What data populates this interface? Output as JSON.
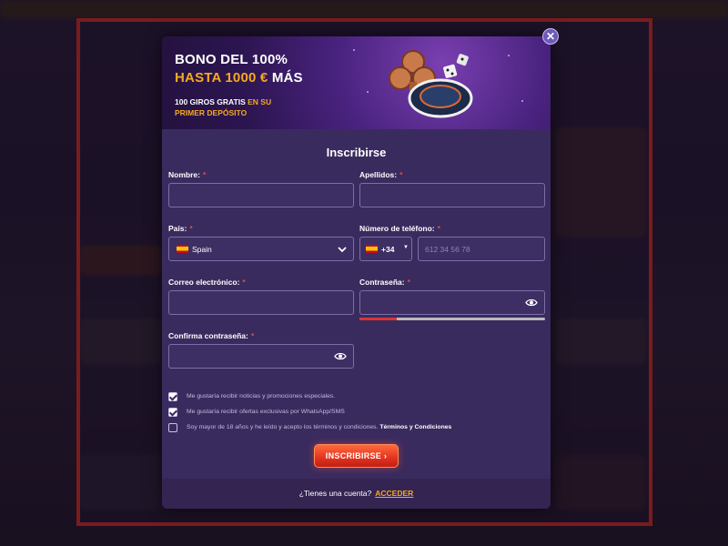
{
  "banner": {
    "line1": "BONO DEL 100%",
    "line2_accent": "HASTA 1000 €",
    "line2_white": " MÁS",
    "sub_white": "100 GIROS GRATIS",
    "sub_accent": " EN SU PRIMER DEPÓSITO"
  },
  "close_label": "✕",
  "form": {
    "title": "Inscribirse",
    "required_mark": "*",
    "first_name": {
      "label": "Nombre:",
      "value": ""
    },
    "last_name": {
      "label": "Apellidos:",
      "value": ""
    },
    "country": {
      "label": "País:",
      "value": "Spain"
    },
    "phone": {
      "label": "Número de teléfono:",
      "code": "+34",
      "placeholder": "612 34 56 78"
    },
    "email": {
      "label": "Correo electrónico:",
      "value": ""
    },
    "password": {
      "label": "Contraseña:",
      "strength": 0.2
    },
    "confirm_password": {
      "label": "Confirma contraseña:"
    },
    "checkboxes": [
      {
        "text": "Me gustaría recibir noticias y promociones especiales.",
        "checked": true
      },
      {
        "text": "Me gustaría recibir ofertas exclusivas por WhatsApp/SMS",
        "checked": true
      },
      {
        "text": "Soy mayor de 18 años y he leído y acepto los términos y condiciones.",
        "link": "Términos y Condiciones",
        "checked": false
      }
    ],
    "submit_label": "INSCRIBIRSE ›"
  },
  "footer": {
    "question": "¿Tienes una cuenta?",
    "login_link": "ACCEDER"
  },
  "colors": {
    "accent": "#f7a823",
    "modal_bg": "#3a2b5e",
    "frame": "#7a1c1c",
    "submit": "#e2331f",
    "required": "#e24a4a"
  }
}
